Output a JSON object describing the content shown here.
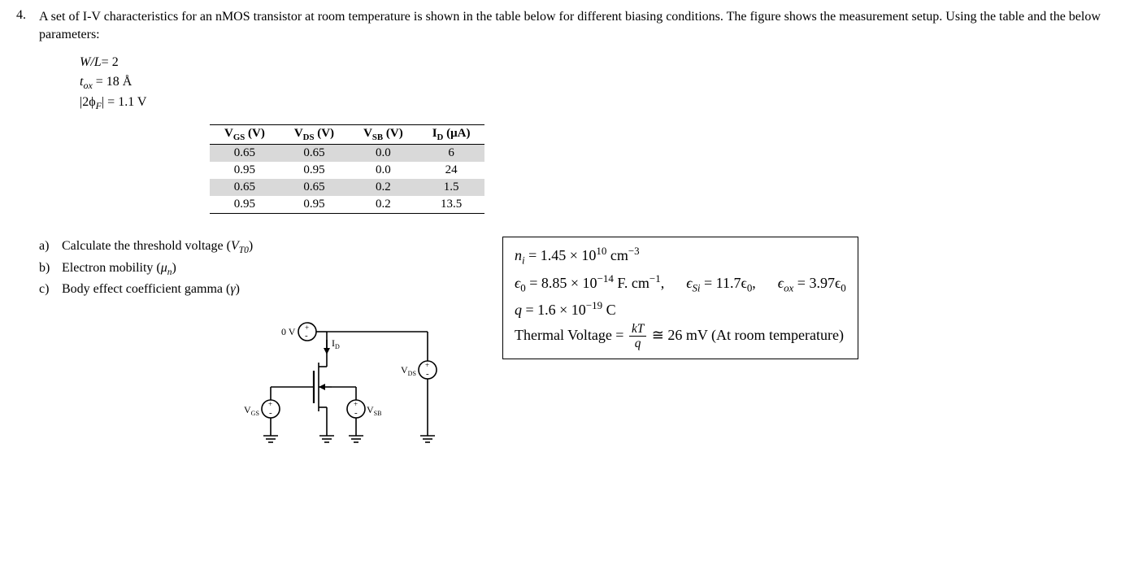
{
  "q_number": "4.",
  "intro": "A set of I-V characteristics for an nMOS transistor at room temperature is shown in the table below for different biasing conditions. The figure shows the measurement setup. Using the table and the below parameters:",
  "params": {
    "line1_lhs": "W/L",
    "line1_rhs": "= 2",
    "line2_lhs_a": "t",
    "line2_lhs_b": "ox",
    "line2_rhs": " = 18 Å",
    "line3_lhs_a": "|2ϕ",
    "line3_lhs_b": "F",
    "line3_lhs_c": "|",
    "line3_rhs": " = 1.1 V"
  },
  "table": {
    "headers": {
      "c1a": "V",
      "c1b": "GS",
      "c1c": " (V)",
      "c2a": "V",
      "c2b": "DS",
      "c2c": " (V)",
      "c3a": "V",
      "c3b": "SB",
      "c3c": " (V)",
      "c4a": "I",
      "c4b": "D",
      "c4c": " (μA)"
    },
    "rows": [
      {
        "shaded": true,
        "cells": [
          "0.65",
          "0.65",
          "0.0",
          "6"
        ]
      },
      {
        "shaded": false,
        "cells": [
          "0.95",
          "0.95",
          "0.0",
          "24"
        ]
      },
      {
        "shaded": true,
        "cells": [
          "0.65",
          "0.65",
          "0.2",
          "1.5"
        ]
      },
      {
        "shaded": false,
        "cells": [
          "0.95",
          "0.95",
          "0.2",
          "13.5"
        ]
      }
    ]
  },
  "subq": {
    "a_label": "a)",
    "a_text_1": "Calculate the threshold voltage  (",
    "a_text_2": "V",
    "a_text_3": "T0",
    "a_text_4": ")",
    "b_label": "b)",
    "b_text_1": "Electron mobility  (",
    "b_text_2": "μ",
    "b_text_3": "n",
    "b_text_4": ")",
    "c_label": "c)",
    "c_text_1": "Body effect coefficient gamma (",
    "c_text_2": "γ",
    "c_text_3": ")"
  },
  "constants": {
    "r1a": "n",
    "r1b": "i",
    "r1c": " = 1.45 × 10",
    "r1d": "10",
    "r1e": " cm",
    "r1f": "−3",
    "r2a": "ϵ",
    "r2b": "0",
    "r2c": " = 8.85 × 10",
    "r2d": "−14",
    "r2e": " F. cm",
    "r2f": "−1",
    "r2g": ",",
    "r2h": "ϵ",
    "r2i": "Si",
    "r2j": " = 11.7ϵ",
    "r2k": "0",
    "r2l": ",",
    "r2m": "ϵ",
    "r2n": "ox",
    "r2o": " = 3.97ϵ",
    "r2p": "0",
    "r3a": "q = 1.6 × 10",
    "r3b": "−19",
    "r3c": " C",
    "r4a": "Thermal Voltage = ",
    "r4num": "kT",
    "r4den": "q",
    "r4b": " ≅ 26 mV (At room temperature)"
  },
  "circuit_labels": {
    "zero_v": "0 V",
    "id": "I",
    "id_sub": "D",
    "vgs": "V",
    "vgs_sub": "GS",
    "vsb": "V",
    "vsb_sub": "SB",
    "vds": "V",
    "vds_sub": "DS"
  }
}
